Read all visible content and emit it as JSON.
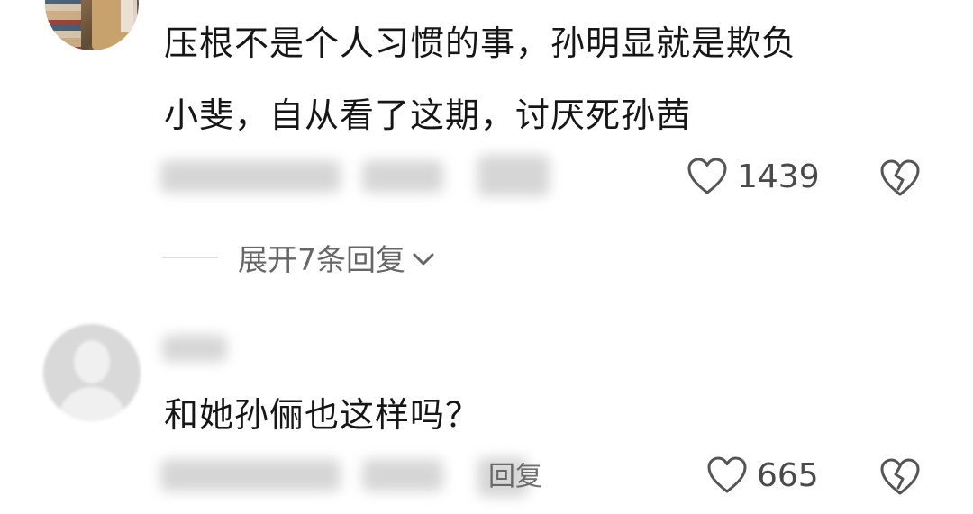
{
  "comments": [
    {
      "text_line1": "压根不是个人习惯的事，孙明显就是欺负",
      "text_line2": "小斐，自从看了这期，讨厌死孙茜",
      "likes": "1439",
      "expand_replies_label": "展开7条回复"
    },
    {
      "text_line1": "和她孙俪也这样吗？",
      "likes": "665",
      "reply_label": "回复"
    }
  ],
  "icons": {
    "like": "heart-icon",
    "dislike": "broken-heart-icon",
    "expand": "chevron-down-icon"
  },
  "colors": {
    "text": "#161616",
    "meta": "#666666",
    "icon": "#555555"
  }
}
